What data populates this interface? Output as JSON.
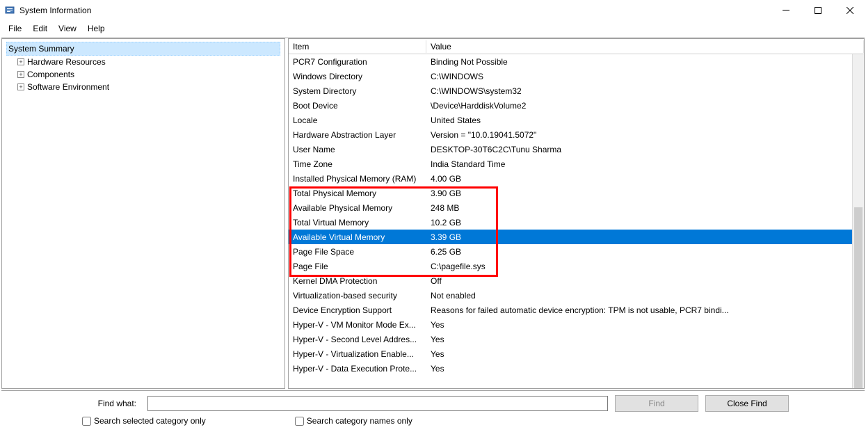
{
  "window": {
    "title": "System Information"
  },
  "menu": {
    "file": "File",
    "edit": "Edit",
    "view": "View",
    "help": "Help"
  },
  "tree": {
    "root": "System Summary",
    "hardware": "Hardware Resources",
    "components": "Components",
    "software": "Software Environment"
  },
  "headers": {
    "item": "Item",
    "value": "Value"
  },
  "rows": [
    {
      "item": "PCR7 Configuration",
      "value": "Binding Not Possible"
    },
    {
      "item": "Windows Directory",
      "value": "C:\\WINDOWS"
    },
    {
      "item": "System Directory",
      "value": "C:\\WINDOWS\\system32"
    },
    {
      "item": "Boot Device",
      "value": "\\Device\\HarddiskVolume2"
    },
    {
      "item": "Locale",
      "value": "United States"
    },
    {
      "item": "Hardware Abstraction Layer",
      "value": "Version = \"10.0.19041.5072\""
    },
    {
      "item": "User Name",
      "value": "DESKTOP-30T6C2C\\Tunu Sharma"
    },
    {
      "item": "Time Zone",
      "value": "India Standard Time"
    },
    {
      "item": "Installed Physical Memory (RAM)",
      "value": "4.00 GB"
    },
    {
      "item": "Total Physical Memory",
      "value": "3.90 GB"
    },
    {
      "item": "Available Physical Memory",
      "value": "248 MB"
    },
    {
      "item": "Total Virtual Memory",
      "value": "10.2 GB"
    },
    {
      "item": "Available Virtual Memory",
      "value": "3.39 GB",
      "selected": true
    },
    {
      "item": "Page File Space",
      "value": "6.25 GB"
    },
    {
      "item": "Page File",
      "value": "C:\\pagefile.sys"
    },
    {
      "item": "Kernel DMA Protection",
      "value": "Off"
    },
    {
      "item": "Virtualization-based security",
      "value": "Not enabled"
    },
    {
      "item": "Device Encryption Support",
      "value": "Reasons for failed automatic device encryption: TPM is not usable, PCR7 bindi..."
    },
    {
      "item": "Hyper-V - VM Monitor Mode Ex...",
      "value": "Yes"
    },
    {
      "item": "Hyper-V - Second Level Addres...",
      "value": "Yes"
    },
    {
      "item": "Hyper-V - Virtualization Enable...",
      "value": "Yes"
    },
    {
      "item": "Hyper-V - Data Execution Prote...",
      "value": "Yes"
    }
  ],
  "find": {
    "label": "Find what:",
    "value": "",
    "findBtn": "Find",
    "closeBtn": "Close Find",
    "chk1": "Search selected category only",
    "chk2": "Search category names only"
  }
}
